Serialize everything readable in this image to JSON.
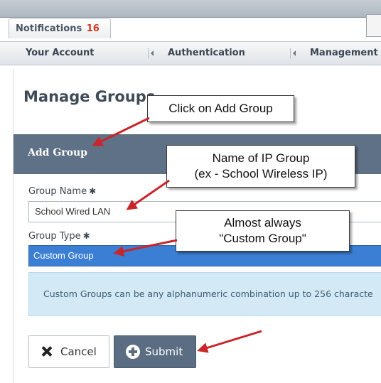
{
  "notifications": {
    "label": "Notifications",
    "count": "16"
  },
  "nav": {
    "your_account": "Your Account",
    "authentication": "Authentication",
    "management": "Management"
  },
  "page": {
    "title": "Manage Groups"
  },
  "add_group": {
    "header": "Add Group",
    "group_name_label": "Group Name",
    "group_name_value": "School Wired LAN",
    "group_type_label": "Group Type",
    "group_type_value": "Custom Group",
    "required_marker": "✱",
    "info_text": "Custom Groups can be any alphanumeric combination up to 256 characte",
    "cancel_label": "Cancel",
    "submit_label": "Submit"
  },
  "callouts": {
    "add_group": "Click on Add Group",
    "ip_group_line1": "Name of IP Group",
    "ip_group_line2": "(ex - School Wireless IP)",
    "custom_line1": "Almost always",
    "custom_line2": "\"Custom Group\""
  },
  "colors": {
    "header": "#5f7186",
    "select_highlight": "#3b7fd4",
    "info_bg": "#d3eaf6",
    "arrow": "#c8262b",
    "badge": "#d0361e"
  },
  "icons": {
    "cancel": "x-icon",
    "submit": "plus-circle-icon",
    "nav_separator": "caret-left-icon"
  }
}
